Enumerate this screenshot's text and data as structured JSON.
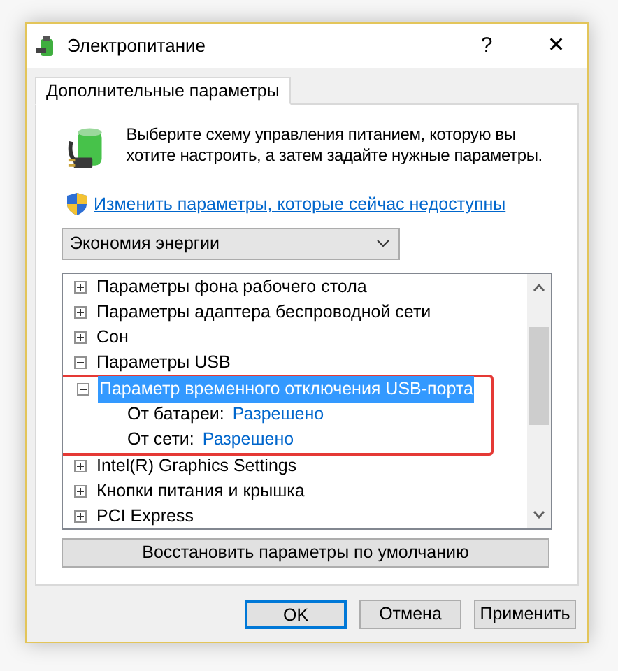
{
  "window": {
    "title": "Электропитание",
    "help": "?",
    "close": "✕"
  },
  "tabs": [
    {
      "label": "Дополнительные параметры",
      "selected": true
    }
  ],
  "intro": "Выберите схему управления питанием, которую вы хотите настроить, а затем задайте нужные параметры.",
  "admin_link": "Изменить параметры, которые сейчас недоступны",
  "plan_dropdown": {
    "value": "Экономия энергии"
  },
  "tree": [
    {
      "label": "Параметры фона рабочего стола",
      "expanded": false,
      "selected": false
    },
    {
      "label": "Параметры адаптера беспроводной сети",
      "expanded": false,
      "selected": false
    },
    {
      "label": "Сон",
      "expanded": false,
      "selected": false
    },
    {
      "label": "Параметры USB",
      "expanded": true,
      "selected": false,
      "children": [
        {
          "label": "Параметр временного отключения USB-порта",
          "expanded": true,
          "selected": true,
          "highlighted": true,
          "children": [
            {
              "label": "От батареи:",
              "value": "Разрешено"
            },
            {
              "label": "От сети:",
              "value": "Разрешено"
            }
          ]
        }
      ]
    },
    {
      "label": "Intel(R) Graphics Settings",
      "expanded": false,
      "selected": false
    },
    {
      "label": "Кнопки питания и крышка",
      "expanded": false,
      "selected": false
    },
    {
      "label": "PCI Express",
      "expanded": false,
      "selected": false
    }
  ],
  "restore_button": "Восстановить параметры по умолчанию",
  "buttons": [
    {
      "label": "OK",
      "focused": true
    },
    {
      "label": "Отмена",
      "focused": false
    },
    {
      "label": "Применить",
      "focused": false
    }
  ]
}
